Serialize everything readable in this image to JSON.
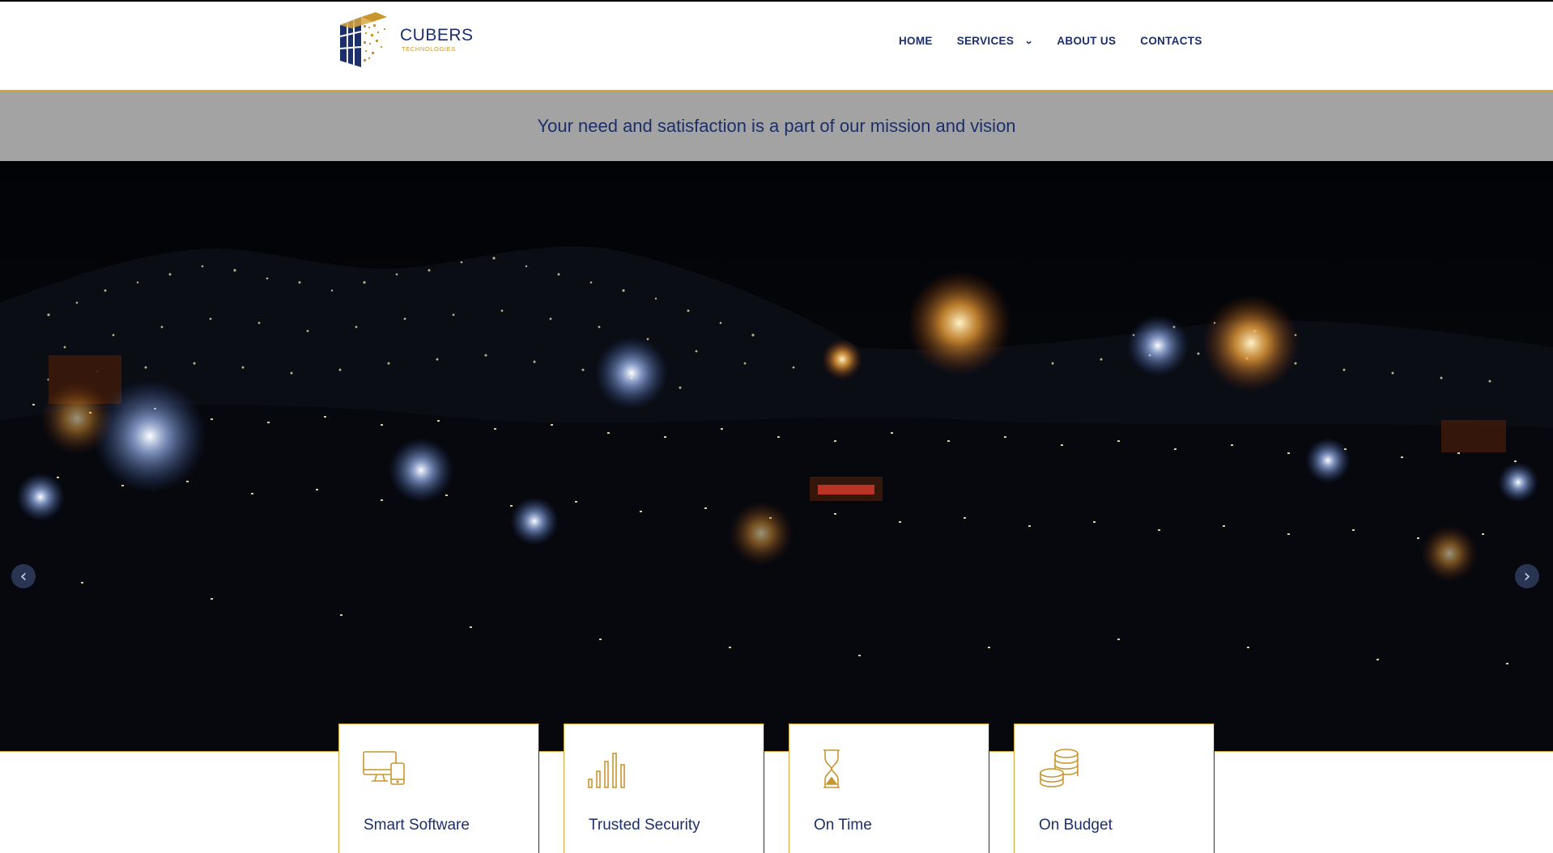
{
  "brand": {
    "name": "CUBERS",
    "subtitle": "TECHNOLOGIES"
  },
  "nav": {
    "items": [
      {
        "label": "HOME"
      },
      {
        "label": "SERVICES"
      },
      {
        "label": "ABOUT US"
      },
      {
        "label": "CONTACTS"
      }
    ]
  },
  "banner": {
    "text": "Your need and satisfaction is a part of our mission and vision"
  },
  "hero": {
    "prev_icon": "chevron-left-icon",
    "next_icon": "chevron-right-icon"
  },
  "features": [
    {
      "label": "Smart Software",
      "icon": "devices-icon"
    },
    {
      "label": "Trusted Security",
      "icon": "bar-chart-icon"
    },
    {
      "label": "On Time",
      "icon": "hourglass-icon"
    },
    {
      "label": "On Budget",
      "icon": "coins-icon"
    }
  ],
  "colors": {
    "navy": "#1c2f6b",
    "gold": "#d4a63c",
    "banner_gray": "#a3a3a3"
  }
}
